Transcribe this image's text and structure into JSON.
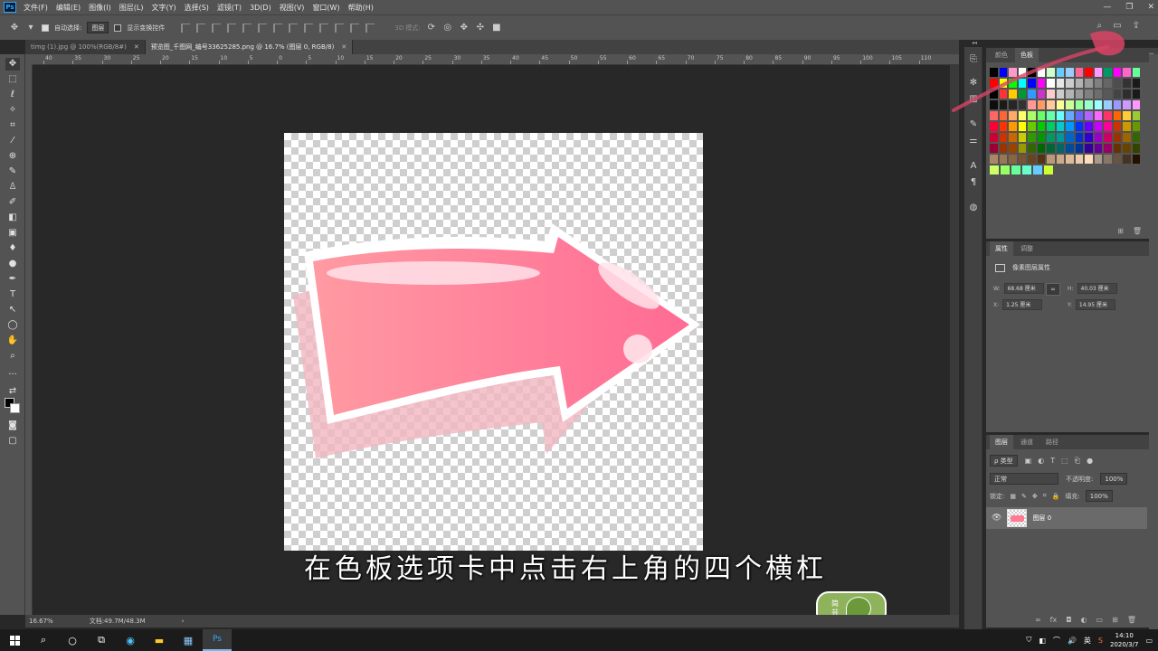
{
  "app": {
    "logo": "Ps",
    "menu": [
      "文件(F)",
      "编辑(E)",
      "图像(I)",
      "图层(L)",
      "文字(Y)",
      "选择(S)",
      "滤镜(T)",
      "3D(D)",
      "视图(V)",
      "窗口(W)",
      "帮助(H)"
    ],
    "window_controls": [
      "—",
      "❐",
      "✕"
    ]
  },
  "options_bar": {
    "auto_select_label": "自动选择:",
    "auto_select_target": "图层",
    "show_transform_label": "显示变换控件",
    "mode3d_label": "3D 模式:"
  },
  "doc_tabs": [
    {
      "label": "timg (1).jpg @ 100%(RGB/8#)",
      "close": "✕",
      "active": false
    },
    {
      "label": "预览图_千图网_编号33625285.png @ 16.7% (图层 0, RGB/8)",
      "close": "✕",
      "active": true
    }
  ],
  "ruler_top_labels": [
    "40",
    "35",
    "30",
    "25",
    "20",
    "15",
    "10",
    "5",
    "0",
    "5",
    "10",
    "15",
    "20",
    "25",
    "30",
    "35",
    "40",
    "45",
    "50",
    "55",
    "60",
    "65",
    "70",
    "75",
    "80",
    "85",
    "90",
    "95",
    "100",
    "105",
    "110"
  ],
  "subtitle": "在色板选项卡中点击右上角的四个横杠",
  "watermark": {
    "text": "简 芸"
  },
  "status": {
    "zoom": "16.67%",
    "doc": "文档:49.7M/48.3M",
    "arrow": "›"
  },
  "swatches_panel": {
    "tabs": [
      "颜色",
      "色板"
    ],
    "active_tab": "色板",
    "rows": [
      [
        "#000000",
        "#0000ff",
        "#ff99cc",
        "#ffffff",
        "#000000",
        "#ffffff",
        "#ccffcc",
        "#66ccff",
        "#99ccff",
        "#ff6699",
        "#ff0000",
        "#ff99ff",
        "#009966",
        "#ff00ff",
        "#ff66cc",
        "#66ff99"
      ],
      [
        "#ff0000",
        "#ffff00",
        "#00ff00",
        "#00ffff",
        "#0000ff",
        "#ff00ff",
        "#ffffff",
        "#e6e6e6",
        "#cccccc",
        "#b3b3b3",
        "#999999",
        "#808080",
        "#666666",
        "#4d4d4d",
        "#333333",
        "#1a1a1a"
      ],
      [
        "#000000",
        "#ff3333",
        "#ffcc00",
        "#009933",
        "#3399ff",
        "#cc33cc",
        "#ffcccc",
        "#cccccc",
        "#b3b3b3",
        "#999999",
        "#808080",
        "#6e6e6e",
        "#595959",
        "#444444",
        "#2e2e2e",
        "#1a1a1a"
      ],
      [
        "#0d0d0d",
        "#1a1a1a",
        "#262626",
        "#333333",
        "#ff9999",
        "#ff9966",
        "#ffcc99",
        "#ffff99",
        "#ccff99",
        "#99ff99",
        "#99ffcc",
        "#99ffff",
        "#99ccff",
        "#9999ff",
        "#cc99ff",
        "#ff99ff"
      ],
      [
        "#ff6666",
        "#ff6633",
        "#ffaa66",
        "#ffff66",
        "#aaff66",
        "#66ff66",
        "#66ffaa",
        "#66ffff",
        "#66aaff",
        "#6666ff",
        "#aa66ff",
        "#ff66ff",
        "#ff3366",
        "#ff6600",
        "#ffcc33",
        "#99cc33"
      ],
      [
        "#ff0033",
        "#ff3300",
        "#ff9900",
        "#ffff00",
        "#66cc00",
        "#00cc00",
        "#00cc66",
        "#00cccc",
        "#0099ff",
        "#0033ff",
        "#6600ff",
        "#cc00ff",
        "#ff0099",
        "#cc3300",
        "#cc9900",
        "#669900"
      ],
      [
        "#cc0033",
        "#cc3300",
        "#cc6600",
        "#cccc00",
        "#339900",
        "#009900",
        "#009966",
        "#009999",
        "#0066cc",
        "#0033cc",
        "#3300cc",
        "#9900cc",
        "#cc0066",
        "#993300",
        "#996600",
        "#336600"
      ],
      [
        "#990033",
        "#993300",
        "#994400",
        "#999900",
        "#336600",
        "#006600",
        "#006633",
        "#006666",
        "#004c99",
        "#003399",
        "#330099",
        "#660099",
        "#990066",
        "#663300",
        "#664400",
        "#334400"
      ],
      [
        "#aa8866",
        "#997755",
        "#886644",
        "#775533",
        "#664422",
        "#553311",
        "#bb9977",
        "#ccaa88",
        "#ddbb99",
        "#eeccaa",
        "#ffddbb",
        "#aa9988",
        "#887766",
        "#665544",
        "#443322",
        "#221100"
      ],
      [
        "#ccff66",
        "#99ff66",
        "#66ff99",
        "#66ffcc",
        "#66ccff",
        "#ccff33"
      ]
    ]
  },
  "properties_panel": {
    "tabs": [
      "属性",
      "调整"
    ],
    "active_tab": "属性",
    "title": "像素图层属性",
    "w_label": "W:",
    "w_value": "68.68 厘米",
    "h_label": "H:",
    "h_value": "40.03 厘米",
    "x_label": "X:",
    "x_value": "1.25 厘米",
    "y_label": "Y:",
    "y_value": "14.95 厘米",
    "link_icon": "∞"
  },
  "layers_panel": {
    "tabs": [
      "图层",
      "通道",
      "路径"
    ],
    "active_tab": "图层",
    "filter": "ρ 类型",
    "blend_mode": "正常",
    "opacity_label": "不透明度:",
    "opacity_value": "100%",
    "lock_label": "锁定:",
    "fill_label": "填充:",
    "fill_value": "100%",
    "layer_name": "图层 0"
  },
  "taskbar": {
    "time": "14:10",
    "date": "2020/3/7",
    "lang": "英",
    "ps_label": "Ps"
  },
  "colors": {
    "arrow_start": "#ff9aa2",
    "arrow_end": "#ff6b94",
    "shadow": "#f2b7c0",
    "ui_panel": "#535353",
    "ui_dark": "#282828",
    "overlay_stroke": "#d84466"
  }
}
